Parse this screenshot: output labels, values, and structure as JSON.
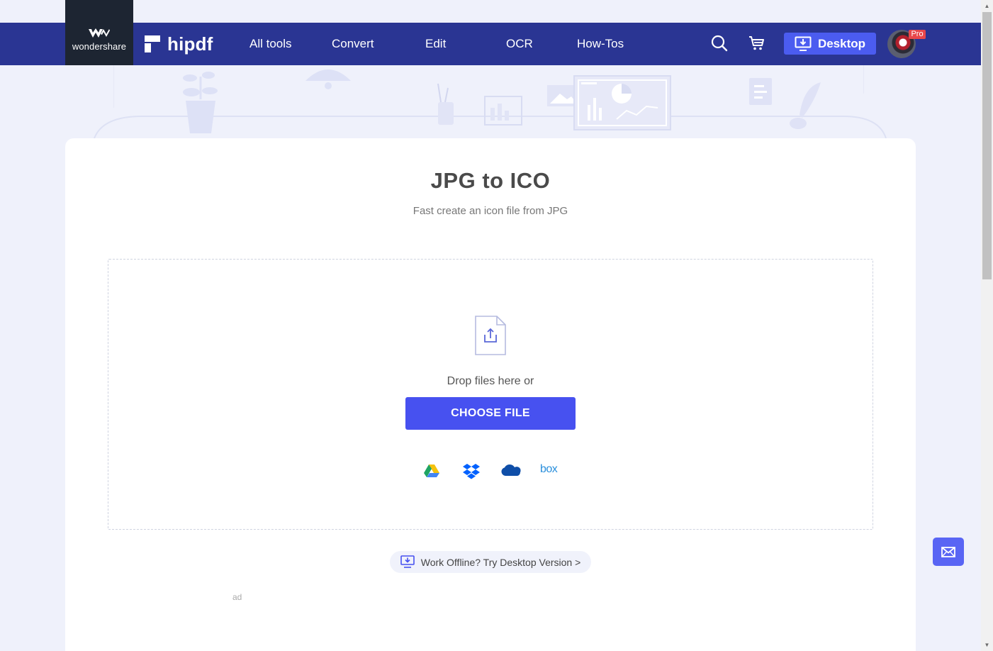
{
  "brand": {
    "wondershare": "wondershare",
    "product": "hipdf"
  },
  "nav": {
    "items": [
      {
        "label": "All tools"
      },
      {
        "label": "Convert"
      },
      {
        "label": "Edit"
      },
      {
        "label": "OCR"
      },
      {
        "label": "How-Tos"
      }
    ],
    "desktop_label": "Desktop",
    "pro_badge": "Pro"
  },
  "icons": {
    "search": "search-icon",
    "cart": "cart-icon",
    "download": "download-monitor-icon",
    "upload": "upload-file-icon",
    "mail": "mail-icon"
  },
  "main": {
    "title": "JPG to ICO",
    "subtitle": "Fast create an icon file from JPG",
    "drop_text": "Drop files here or",
    "choose_label": "CHOOSE FILE",
    "cloud_sources": [
      {
        "name": "google-drive"
      },
      {
        "name": "dropbox"
      },
      {
        "name": "onedrive"
      },
      {
        "name": "box",
        "label": "box"
      }
    ],
    "offline_text": "Work Offline? Try Desktop Version >",
    "ad_label": "ad"
  },
  "colors": {
    "header_bg": "#2a3593",
    "logo_bg": "#1d2532",
    "accent": "#4751f0",
    "page_bg": "#eff1fb",
    "pro_badge": "#e8474a"
  }
}
